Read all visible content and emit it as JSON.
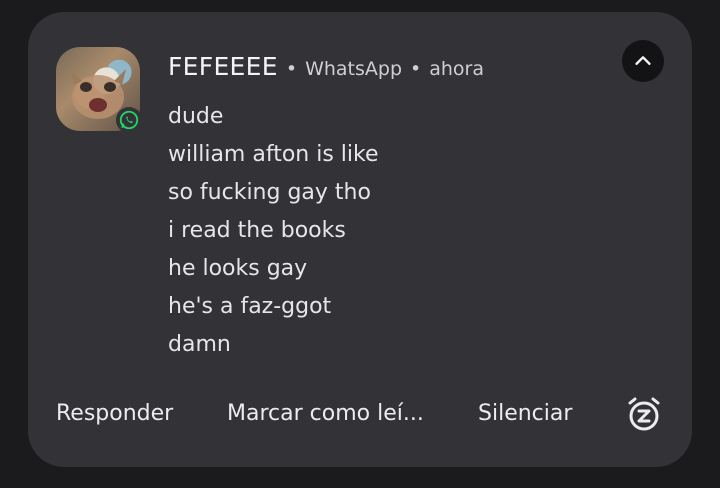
{
  "notification": {
    "sender": "FEFEEEE",
    "app_name": "WhatsApp",
    "time": "ahora",
    "separator": "•",
    "messages": [
      "dude",
      "william afton is like",
      "so fucking gay tho",
      "i read the books",
      "he looks gay",
      "he's a faz-ggot",
      "damn"
    ],
    "actions": {
      "reply": "Responder",
      "mark_read": "Marcar como leí...",
      "mute": "Silenciar"
    }
  },
  "icons": {
    "avatar": "avatar",
    "app_badge": "whatsapp-icon",
    "collapse": "chevron-up-icon",
    "snooze": "snooze-alarm-icon"
  },
  "colors": {
    "card_background": "#323237",
    "page_background": "#1b1b1e",
    "whatsapp_green": "#25d366",
    "collapse_button": "#131316"
  }
}
